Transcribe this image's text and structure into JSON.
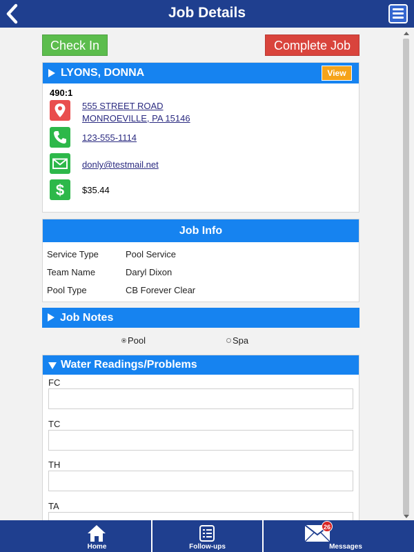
{
  "header": {
    "title": "Job Details",
    "back_icon": "chevron-left-icon",
    "menu_icon": "hamburger-menu-icon"
  },
  "actions": {
    "check_in_label": "Check In",
    "complete_job_label": "Complete Job"
  },
  "customer": {
    "name": "LYONS, DONNA",
    "view_label": "View",
    "id": "490:1",
    "address_line1": "555 STREET ROAD",
    "address_line2": "MONROEVILLE, PA 15146",
    "phone": "123-555-1114",
    "email": "donly@testmail.net",
    "balance": "$35.44"
  },
  "job_info": {
    "title": "Job Info",
    "rows": [
      {
        "label": "Service Type",
        "value": "Pool Service"
      },
      {
        "label": "Team Name",
        "value": "Daryl Dixon"
      },
      {
        "label": "Pool Type",
        "value": "CB Forever Clear"
      }
    ]
  },
  "job_notes": {
    "title": "Job Notes"
  },
  "pool_spa": {
    "options": [
      "Pool",
      "Spa"
    ],
    "selected": "Pool"
  },
  "water_readings": {
    "title": "Water Readings/Problems",
    "fields": [
      {
        "label": "FC",
        "value": ""
      },
      {
        "label": "TC",
        "value": ""
      },
      {
        "label": "TH",
        "value": ""
      },
      {
        "label": "TA",
        "value": ""
      }
    ]
  },
  "bottom_nav": {
    "items": [
      {
        "label": "Home",
        "icon": "home-icon"
      },
      {
        "label": "Follow-ups",
        "icon": "checklist-icon"
      },
      {
        "label": "Messages",
        "icon": "envelope-icon",
        "badge": "26"
      }
    ]
  },
  "colors": {
    "header_bg": "#1f3f8f",
    "panel_header": "#1683f0",
    "check_in": "#5cbd4d",
    "complete_job": "#d9443c",
    "view_button": "#f5a31a"
  }
}
